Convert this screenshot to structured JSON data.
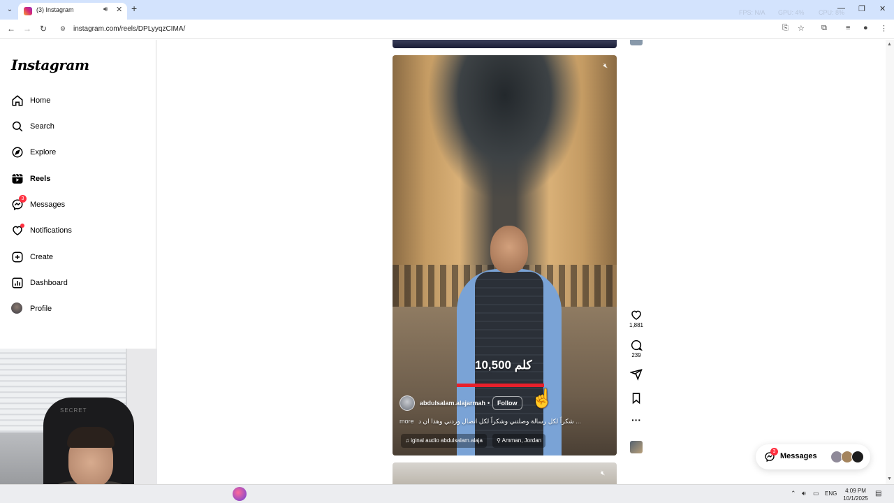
{
  "browser": {
    "tab_title": "(3) Instagram",
    "url": "instagram.com/reels/DPLyyqzCIMA/",
    "perf": {
      "fps": "FPS: N/A",
      "gpu": "GPU: 4%",
      "cpu": "CPU: 8%"
    }
  },
  "sidebar": {
    "logo": "Instagram",
    "items": [
      {
        "label": "Home",
        "icon": "home-icon"
      },
      {
        "label": "Search",
        "icon": "search-icon"
      },
      {
        "label": "Explore",
        "icon": "explore-icon"
      },
      {
        "label": "Reels",
        "icon": "reels-icon",
        "active": true
      },
      {
        "label": "Messages",
        "icon": "messenger-icon",
        "badge": "3"
      },
      {
        "label": "Notifications",
        "icon": "heart-icon",
        "dot": true
      },
      {
        "label": "Create",
        "icon": "plus-square-icon"
      },
      {
        "label": "Dashboard",
        "icon": "chart-icon"
      },
      {
        "label": "Profile",
        "icon": "avatar"
      }
    ]
  },
  "reel": {
    "overlay_text": "10,500 كلم",
    "author": "abdulsalam.alajarmah",
    "separator": "•",
    "follow_label": "Follow",
    "caption_more": "more",
    "caption": "شكراً لكل رسالة وصلتني وشكراً لكل اتصال وردني وهذا ان د ...",
    "audio": "iginal audio   abdulsalam.alaja",
    "location": "Amman, Jordan",
    "likes": "1,881",
    "comments": "239"
  },
  "messages_pill": {
    "label": "Messages",
    "badge": "3"
  },
  "webcam": {
    "chair_logo": "SECRET"
  },
  "taskbar": {
    "lang": "ENG",
    "time": "4:09 PM",
    "date": "10/1/2025"
  },
  "colors": {
    "accent_red": "#ff3040",
    "tab_bar": "#d3e3fd",
    "overlay_bar": "#e8202b"
  }
}
